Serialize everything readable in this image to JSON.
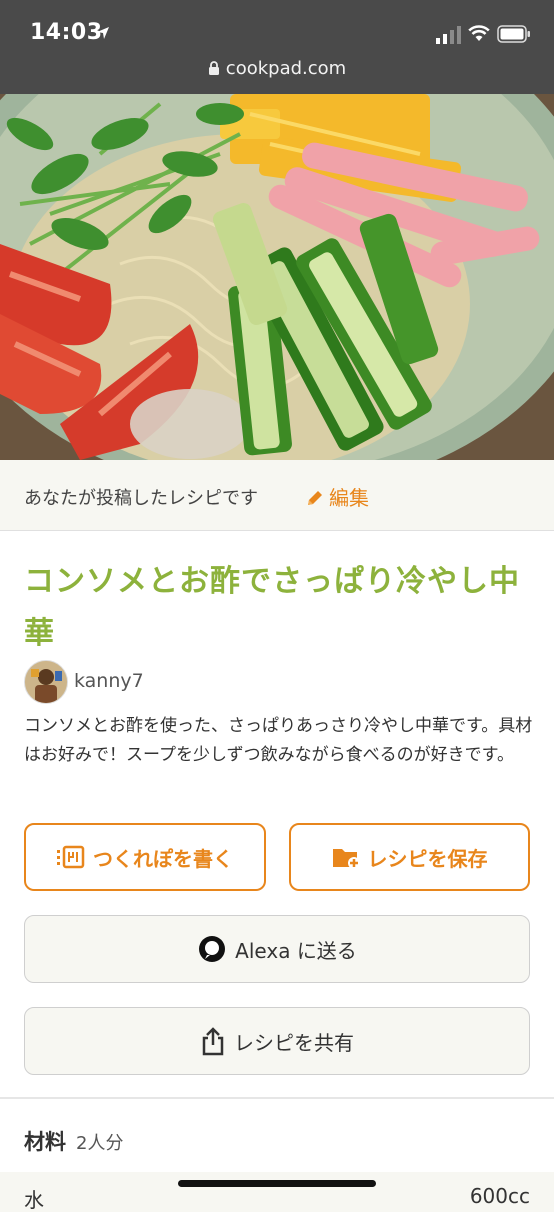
{
  "status_bar": {
    "time": "14:03"
  },
  "browser": {
    "url": "cookpad.com"
  },
  "owner_banner": {
    "text": "あなたが投稿したレシピです",
    "edit_label": "編集"
  },
  "recipe": {
    "title": "コンソメとお酢でさっぱり冷やし中華",
    "author": "kanny7",
    "description": "コンソメとお酢を使った、さっぱりあっさり冷やし中華です。具材はお好みで！スープを少しずつ飲みながら食べるのが好きです。"
  },
  "buttons": {
    "tsukurepo": "つくれぽを書く",
    "save": "レシピを保存",
    "alexa": "Alexa に送る",
    "share": "レシピを共有"
  },
  "ingredients": {
    "title": "材料",
    "servings": "2人分",
    "items": [
      {
        "name": "水",
        "qty": "600cc"
      }
    ]
  },
  "colors": {
    "accent_orange": "#e8861c",
    "title_green": "#8db23c"
  },
  "icons": [
    "location-arrow-icon",
    "signal-icon",
    "wifi-icon",
    "battery-icon",
    "lock-icon",
    "pencil-icon",
    "tsukurepo-icon",
    "folder-add-icon",
    "alexa-icon",
    "share-icon"
  ]
}
